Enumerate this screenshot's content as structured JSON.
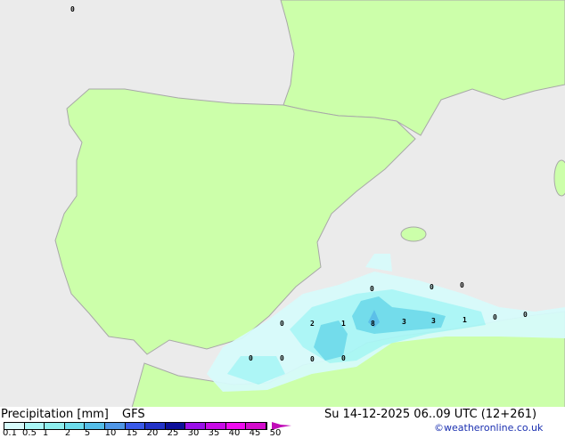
{
  "map": {
    "colors": {
      "sea": "#ebebeb",
      "land": "#ccffaa",
      "border": "#a8a8a8"
    },
    "value_labels": [
      "0",
      "0",
      "0",
      "0",
      "0",
      "2",
      "1",
      "8",
      "3",
      "3",
      "1",
      "0",
      "0",
      "0",
      "0",
      "0",
      "0",
      "0"
    ]
  },
  "footer": {
    "title": "Precipitation [mm]",
    "model": "GFS",
    "datetime": "Su 14-12-2025 06..09 UTC (12+261)",
    "credit": "©weatheronline.co.uk"
  },
  "legend": {
    "ticks": [
      "0.1",
      "0.5",
      "1",
      "2",
      "5",
      "10",
      "15",
      "20",
      "25",
      "30",
      "35",
      "40",
      "45",
      "50"
    ],
    "colors": [
      "#d7fbfb",
      "#aaf7f7",
      "#8eeeee",
      "#6ddcec",
      "#55bde8",
      "#4f96e6",
      "#3a5ae8",
      "#2233c8",
      "#0d0f9a",
      "#9a10e8",
      "#c80ce6",
      "#ee0cee",
      "#d40ccc"
    ]
  }
}
